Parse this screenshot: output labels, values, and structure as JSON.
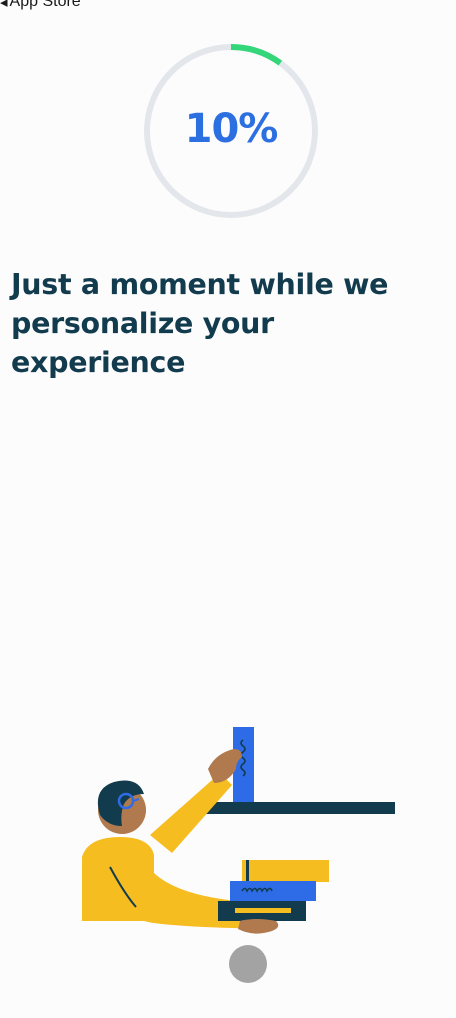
{
  "status_bar": {
    "back_label": "App Store",
    "back_icon": "chevron-left-icon"
  },
  "progress": {
    "label": "10%",
    "value": 0.1,
    "track_color": "#e3e7ec",
    "fill_color": "#34d67a",
    "text_color": "#2b6fe0"
  },
  "headline": {
    "text": "Just a moment while we personalize your experience",
    "color": "#123b4e"
  },
  "illustration": {
    "name": "person-shelving-books-illustration"
  },
  "colors": {
    "background": "#fdfcfd",
    "navy": "#123b4e",
    "yellow": "#f5bd1f",
    "blue": "#2e6be6"
  }
}
